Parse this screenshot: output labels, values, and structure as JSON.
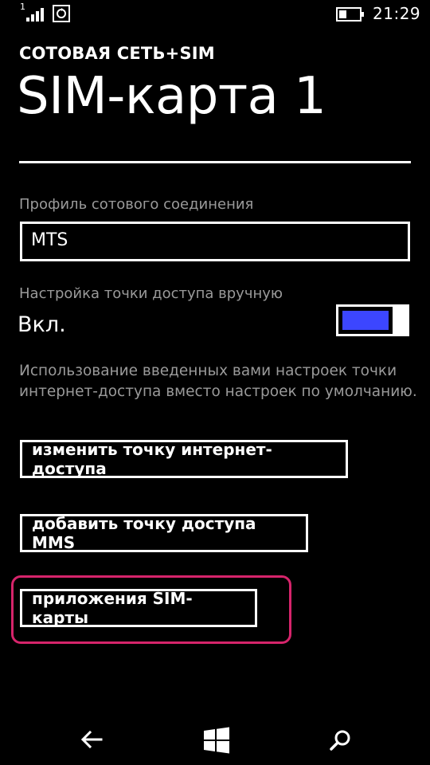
{
  "status_bar": {
    "signal_label": "1",
    "time": "21:29",
    "icons": [
      "signal-icon",
      "sync-icon",
      "battery-icon"
    ]
  },
  "header": {
    "section_title": "СОТОВАЯ СЕТЬ+SIM",
    "page_title": "SIM-карта 1"
  },
  "profile": {
    "label": "Профиль сотового соединения",
    "value": "MTS"
  },
  "manual_access_point": {
    "label": "Настройка точки доступа вручную",
    "state_text": "Вкл.",
    "enabled": true,
    "description": "Использование введенных вами настроек точки интернет-доступа вместо настроек по умолчанию."
  },
  "buttons": {
    "edit_internet_ap": "изменить точку интернет-доступа",
    "add_mms_ap": "добавить точку доступа MMS",
    "sim_apps": "приложения SIM-карты"
  },
  "colors": {
    "background": "#000000",
    "foreground": "#ffffff",
    "secondary_text": "#9a9a9a",
    "accent": "#3c46ff",
    "highlight": "#d6246b"
  },
  "nav_bar": {
    "icons": [
      "back-arrow-icon",
      "windows-start-icon",
      "search-icon"
    ]
  }
}
